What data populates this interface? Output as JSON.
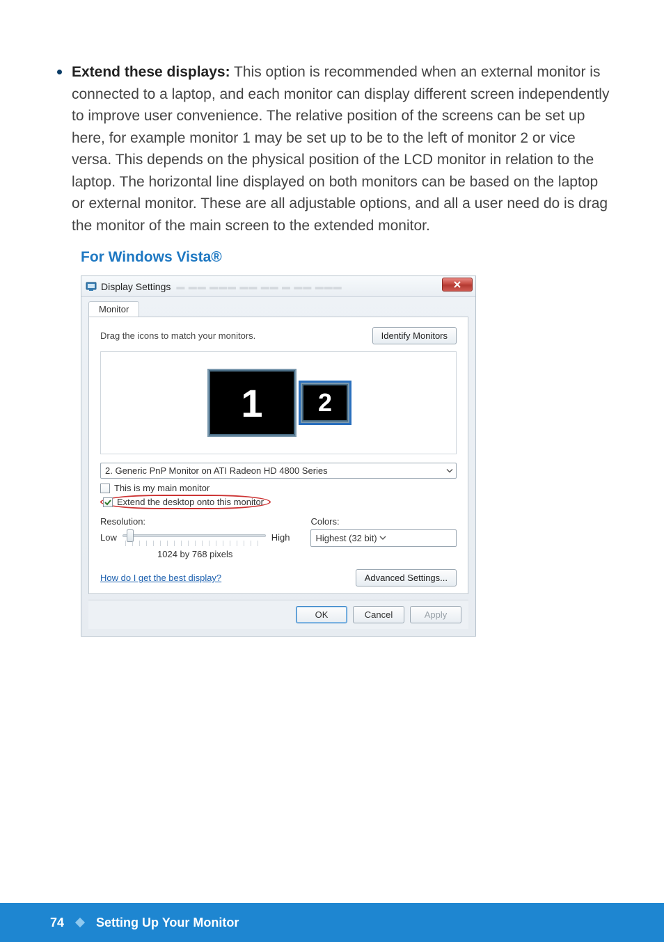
{
  "bullet": {
    "lead": "Extend these displays:",
    "body": " This option is recommended when an external monitor is connected to a laptop, and each monitor can display different screen independently to improve user convenience. The relative position of the screens can be set up here, for example monitor 1 may be set up to be to the left of monitor 2 or vice versa. This depends on the physical position of the LCD monitor in relation to the laptop. The horizontal line displayed on both monitors can be based on the laptop or external monitor. These are all adjustable options, and all a user need do is drag the monitor of the main screen to the extended monitor."
  },
  "subhead": "For Windows Vista®",
  "dialog": {
    "title": "Display Settings",
    "tab": "Monitor",
    "hint": "Drag the icons to match your monitors.",
    "identify_btn": "Identify Monitors",
    "monitor1_num": "1",
    "monitor2_num": "2",
    "monitor_select": "2. Generic PnP Monitor on ATI Radeon HD 4800 Series",
    "chk_main": "This is my main monitor",
    "chk_extend": "Extend the desktop onto this monitor",
    "res_label": "Resolution:",
    "low": "Low",
    "high": "High",
    "res_value": "1024 by 768 pixels",
    "colors_label": "Colors:",
    "colors_value": "Highest (32 bit)",
    "help_link": "How do I get the best display?",
    "adv_btn": "Advanced Settings...",
    "ok": "OK",
    "cancel": "Cancel",
    "apply": "Apply"
  },
  "footer": {
    "page": "74",
    "section": "Setting Up Your Monitor"
  }
}
